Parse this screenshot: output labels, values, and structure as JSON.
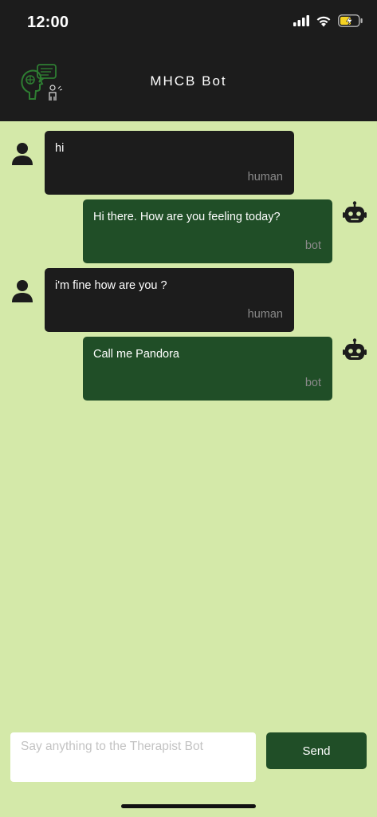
{
  "status_bar": {
    "time": "12:00",
    "icons": [
      "signal-icon",
      "wifi-icon",
      "battery-charging-icon"
    ]
  },
  "header": {
    "title": "MHCB Bot",
    "logo_icon": "therapy-chat-logo-icon"
  },
  "messages": [
    {
      "sender": "human",
      "text": "hi",
      "sender_label": "human"
    },
    {
      "sender": "bot",
      "text": "Hi there. How are you feeling today?",
      "sender_label": "bot"
    },
    {
      "sender": "human",
      "text": "i'm fine how are you ?",
      "sender_label": "human"
    },
    {
      "sender": "bot",
      "text": "Call me Pandora",
      "sender_label": "bot"
    }
  ],
  "composer": {
    "placeholder": "Say anything to the Therapist Bot",
    "send_label": "Send"
  },
  "colors": {
    "background": "#d4e9a9",
    "header": "#1c1c1c",
    "human_bubble": "#1c1c1c",
    "bot_bubble": "#204e27",
    "accent_green": "#2e7d32",
    "battery_yellow": "#f5d222"
  }
}
